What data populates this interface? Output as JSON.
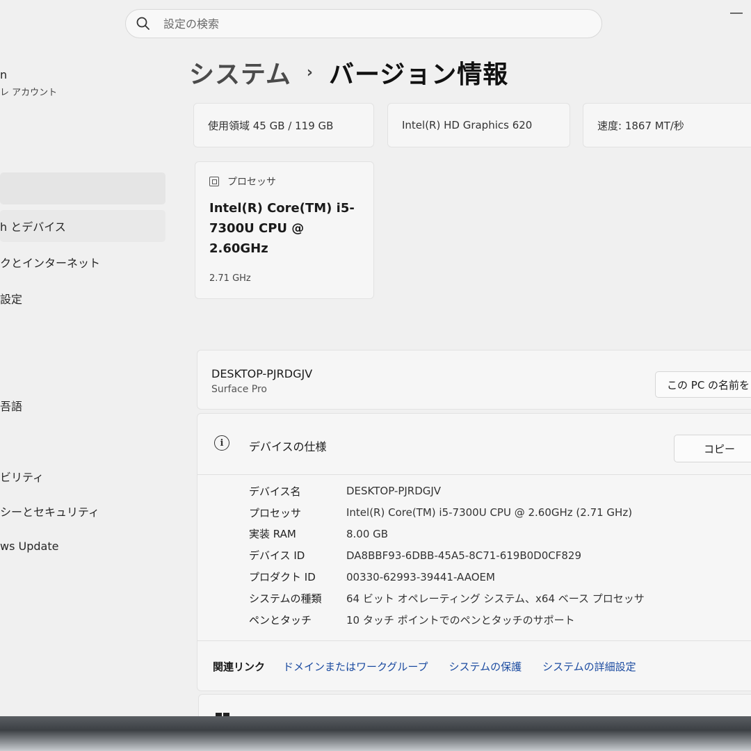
{
  "search": {
    "placeholder": "設定の検索"
  },
  "sidebar": {
    "profile_name": "n",
    "profile_sub": "レ アカウント",
    "items": [
      {
        "label": ""
      },
      {
        "label": "h とデバイス"
      },
      {
        "label": "クとインターネット"
      },
      {
        "label": "設定"
      },
      {
        "label": ""
      },
      {
        "label": ""
      },
      {
        "label": "吾語"
      },
      {
        "label": ""
      },
      {
        "label": "ビリティ"
      },
      {
        "label": "シーとセキュリティ"
      },
      {
        "label": "ws Update"
      }
    ]
  },
  "breadcrumb": {
    "parent": "システム",
    "separator": "›",
    "current": "バージョン情報"
  },
  "top_cards": {
    "storage": "使用領域 45 GB / 119 GB",
    "graphics": "Intel(R) HD Graphics 620",
    "memory": "速度: 1867 MT/秒"
  },
  "processor_card": {
    "heading": "プロセッサ",
    "name": "Intel(R) Core(TM) i5-7300U CPU @ 2.60GHz",
    "speed": "2.71 GHz"
  },
  "device": {
    "name": "DESKTOP-PJRDGJV",
    "model": "Surface Pro",
    "rename_label": "この PC の名前を"
  },
  "specs": {
    "title": "デバイスの仕様",
    "copy_label": "コピー",
    "rows": [
      {
        "key": "デバイス名",
        "value": "DESKTOP-PJRDGJV"
      },
      {
        "key": "プロセッサ",
        "value": "Intel(R) Core(TM) i5-7300U CPU @ 2.60GHz (2.71 GHz)"
      },
      {
        "key": "実装 RAM",
        "value": "8.00 GB"
      },
      {
        "key": "デバイス ID",
        "value": "DA8BBF93-6DBB-45A5-8C71-619B0D0CF829"
      },
      {
        "key": "プロダクト ID",
        "value": "00330-62993-39441-AAOEM"
      },
      {
        "key": "システムの種類",
        "value": "64 ビット オペレーティング システム、x64 ベース プロセッサ"
      },
      {
        "key": "ペンとタッチ",
        "value": "10 タッチ ポイントでのペンとタッチのサポート"
      }
    ]
  },
  "related": {
    "label": "関連リンク",
    "links": [
      "ドメインまたはワークグループ",
      "システムの保護",
      "システムの詳細設定"
    ]
  },
  "icons": {
    "search": "search-icon",
    "processor": "chip-icon",
    "info": "info-icon",
    "windows": "windows-icon"
  }
}
